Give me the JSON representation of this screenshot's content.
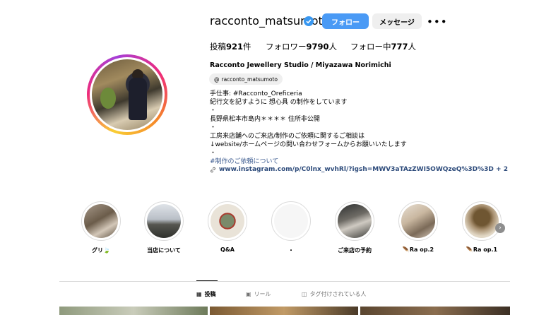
{
  "profile": {
    "username": "racconto_matsumoto",
    "follow_label": "フォロー",
    "message_label": "メッセージ",
    "more_label": "•••",
    "stats": {
      "posts_prefix": "投稿",
      "posts_count": "921",
      "posts_suffix": "件",
      "followers_prefix": "フォロワー",
      "followers_count": "9790",
      "followers_suffix": "人",
      "following_prefix": "フォロー中",
      "following_count": "777",
      "following_suffix": "人"
    },
    "full_name": "Racconto Jewellery Studio / Miyazawa Norimichi",
    "threads_handle": "racconto_matsumoto",
    "bio_lines": [
      "手仕事: #Racconto_Oreficeria",
      "紀行文を記すように 想心具 の制作をしています",
      "・",
      "長野県松本市島内＊＊＊＊ 住所非公開",
      "・",
      "工房来店舗へのご来店/制作のご依頼に関するご相談は",
      "↓website/ホームページの問い合わせフォームからお願いいたします",
      "・"
    ],
    "bio_link": "#制作のご依頼について",
    "external_link": "www.instagram.com/p/C0lnx_wvhRl/?igsh=MWV3aTAzZWI5OWQzeQ%3D%3D + 2"
  },
  "highlights": [
    {
      "label": "グリ🍃"
    },
    {
      "label": "当店について"
    },
    {
      "label": "Q&A"
    },
    {
      "label": "・"
    },
    {
      "label": "ご来店の予約"
    },
    {
      "label": "🪶Ra op.2"
    },
    {
      "label": "🪶Ra op.1"
    }
  ],
  "tabs": {
    "posts": "投稿",
    "reels": "リール",
    "tagged": "タグ付けされている人"
  },
  "colors": {
    "accent": "#4a9af5",
    "link": "#3b5a8f",
    "verified": "#3897f0"
  }
}
